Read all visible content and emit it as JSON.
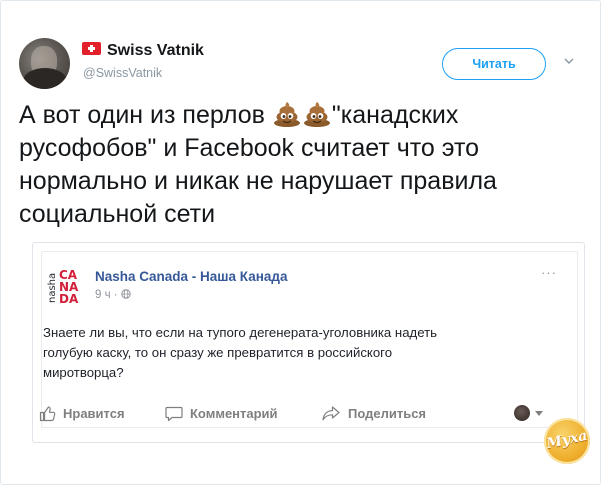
{
  "tweet": {
    "display_name": "Swiss Vatnik",
    "handle": "@SwissVatnik",
    "follow_label": "Читать",
    "text_lines": [
      "А вот один из перлов",
      "\"канадских",
      "русофобов\" и Facebook считает что это",
      "нормально и никак не нарушает правила",
      "социальной сети"
    ],
    "inline_emoji": [
      "pile-of-poo",
      "pile-of-poo"
    ]
  },
  "embedded_post": {
    "page_name": "Nasha Canada - Наша Канада",
    "logo_text": "nasha CANADA",
    "time": "9 ч · ",
    "more_label": "···",
    "text_lines": [
      "Знаете ли вы, что если на тупого дегенерата-уголовника надеть",
      "голубую каску, то он сразу же превратится в российского",
      "миротворца?"
    ],
    "actions": {
      "like": "Нравится",
      "comment": "Комментарий",
      "share": "Поделиться"
    }
  },
  "watermark": {
    "text": "Муха"
  },
  "colors": {
    "follow_blue": "#1da1f2",
    "fb_link": "#365899",
    "flag_red": "#e2202a",
    "muted": "#8a97a2"
  }
}
